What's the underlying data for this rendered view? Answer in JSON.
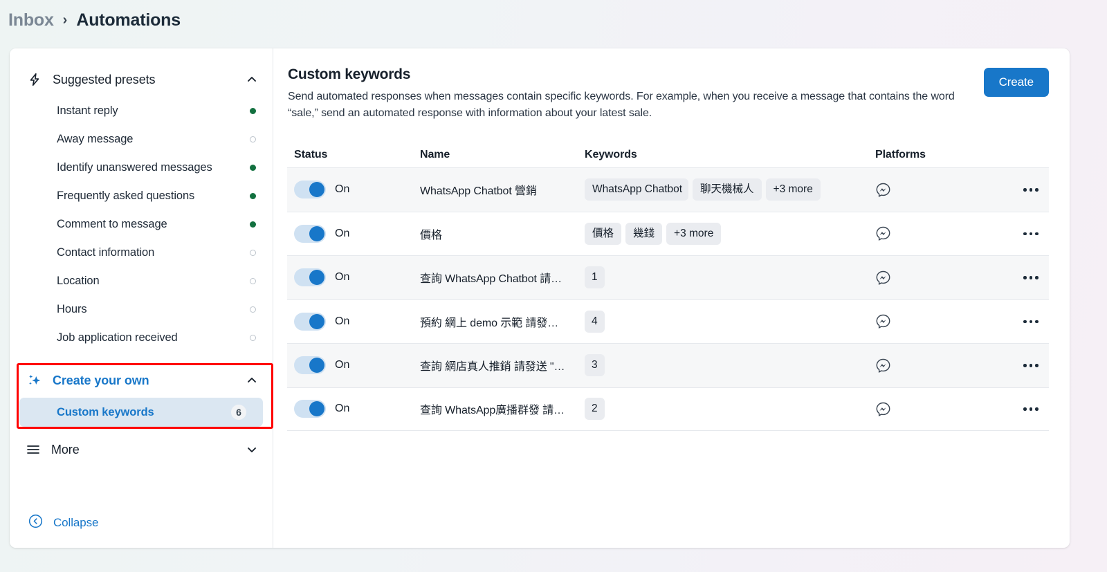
{
  "breadcrumb": {
    "parent": "Inbox",
    "separator": "›",
    "current": "Automations"
  },
  "sidebar": {
    "presets_section": {
      "label": "Suggested presets",
      "icon": "lightning-bolt-icon",
      "expanded": true,
      "items": [
        {
          "label": "Instant reply",
          "status": "on"
        },
        {
          "label": "Away message",
          "status": "off"
        },
        {
          "label": "Identify unanswered messages",
          "status": "on"
        },
        {
          "label": "Frequently asked questions",
          "status": "on"
        },
        {
          "label": "Comment to message",
          "status": "on"
        },
        {
          "label": "Contact information",
          "status": "off"
        },
        {
          "label": "Location",
          "status": "off"
        },
        {
          "label": "Hours",
          "status": "off"
        },
        {
          "label": "Job application received",
          "status": "off"
        }
      ]
    },
    "own_section": {
      "label": "Create your own",
      "icon": "sparkles-icon",
      "expanded": true,
      "highlighted": true,
      "highlight_color": "#ff0000",
      "items": [
        {
          "label": "Custom keywords",
          "count": "6",
          "selected": true
        }
      ]
    },
    "more_section": {
      "label": "More",
      "icon": "hamburger-icon",
      "expanded": false
    },
    "collapse": {
      "label": "Collapse",
      "icon": "chevron-left-circle-icon"
    }
  },
  "main": {
    "title": "Custom keywords",
    "description": "Send automated responses when messages contain specific keywords. For example, when you receive a message that contains the word “sale,” send an automated response with information about your latest sale.",
    "create_label": "Create",
    "columns": {
      "status": "Status",
      "name": "Name",
      "keywords": "Keywords",
      "platforms": "Platforms"
    },
    "rows": [
      {
        "status": "On",
        "toggle_on": true,
        "name": "WhatsApp Chatbot 營銷",
        "keywords": [
          "WhatsApp Chatbot",
          "聊天機械人",
          "+3 more"
        ],
        "platform": "messenger-icon"
      },
      {
        "status": "On",
        "toggle_on": true,
        "name": "價格",
        "keywords": [
          "價格",
          "幾錢",
          "+3 more"
        ],
        "platform": "messenger-icon"
      },
      {
        "status": "On",
        "toggle_on": true,
        "name": "查詢 WhatsApp Chatbot 請…",
        "keywords": [
          "1"
        ],
        "platform": "messenger-icon"
      },
      {
        "status": "On",
        "toggle_on": true,
        "name": "預約 網上 demo 示範 請發…",
        "keywords": [
          "4"
        ],
        "platform": "messenger-icon"
      },
      {
        "status": "On",
        "toggle_on": true,
        "name": "查詢 網店真人推銷 請發送 \"…",
        "keywords": [
          "3"
        ],
        "platform": "messenger-icon"
      },
      {
        "status": "On",
        "toggle_on": true,
        "name": "查詢 WhatsApp廣播群發 請…",
        "keywords": [
          "2"
        ],
        "platform": "messenger-icon"
      }
    ],
    "row_action_label": "…"
  },
  "colors": {
    "accent": "#1877c9",
    "status_on_dot": "#12703f",
    "highlight": "#ff0000",
    "selected_row_bg": "#dbe7f2"
  }
}
